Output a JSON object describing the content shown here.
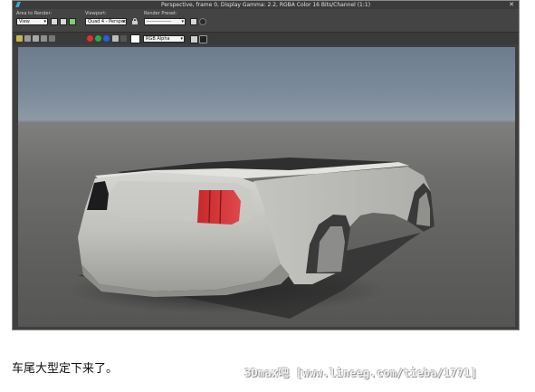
{
  "window": {
    "title": "Perspective, frame 0, Display Gamma: 2.2, RGBA Color 16 Bits/Channel (1:1)",
    "close_glyph": "✕"
  },
  "toolbar": {
    "area_to_render_label": "Area to Render:",
    "area_to_render_value": "View",
    "viewport_label": "Viewport:",
    "viewport_value": "Quad 4 - Perspec",
    "render_preset_label": "Render Preset:",
    "render_preset_value": "---------------",
    "channel_value": "RGB Alpha"
  },
  "colors": {
    "red_channel": "#e03030",
    "green_channel": "#2ea84a",
    "blue_channel": "#2a5fd8",
    "app_accent": "#35a8d8"
  },
  "icons": [
    "app-icon",
    "save-image-icon",
    "copy-image-icon",
    "clone-window-icon",
    "print-icon",
    "lock-icon",
    "environment-icon",
    "render-setup-icon",
    "rgb-toggle-icon",
    "mono-icon",
    "clear-icon",
    "color-swatch-icon",
    "display-toggle-icon"
  ],
  "caption": "车尾大型定下来了。",
  "watermark": "3Dmax吧 [www.lineeg.com/tieba/1771]"
}
